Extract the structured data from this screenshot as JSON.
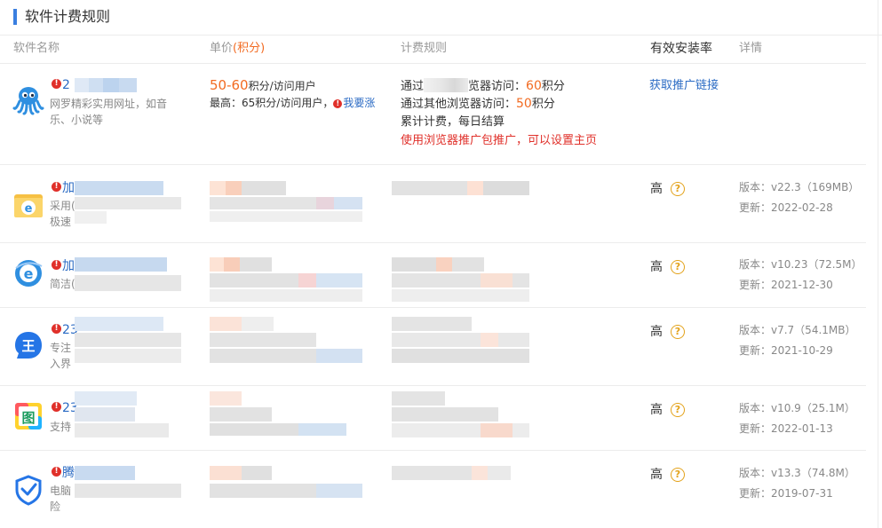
{
  "panel": {
    "title": "软件计费规则",
    "accent_color": "#3a7fe0"
  },
  "table": {
    "headers": {
      "name": "软件名称",
      "price": "单价",
      "price_suffix": "(积分)",
      "rule": "计费规则",
      "rate": "有效安装率",
      "detail": "详情"
    }
  },
  "featured": {
    "icon": "octopus-icon",
    "name": "2",
    "desc_line1": "网罗精彩实用网址，如音",
    "desc_line2": "乐、小说等",
    "price_range": "50-60",
    "price_unit": "积分/访问用户",
    "max_text": "最高：65积分/访问用户，",
    "raise_link": "我要涨",
    "rule1_prefix": "通过",
    "rule1_suffix": "览器访问：",
    "rule1_num": "60",
    "rule1_unit": "积分",
    "rule2_prefix": "通过其他浏览器访问：",
    "rule2_num": "50",
    "rule2_unit": "积分",
    "rule3": "累计计费，每日结算",
    "rule4": "使用浏览器推广包推广，可以设置主页",
    "action": "获取推广链接"
  },
  "rows": [
    {
      "icon": "ie-folder-icon",
      "name": "加",
      "desc_line1": "采用(",
      "desc_line2": "极速",
      "rate": "高",
      "version": "版本：v22.3（169MB）",
      "updated": "更新：2022-02-28"
    },
    {
      "icon": "ie-browser-icon",
      "name": "加",
      "desc_line1": "简洁(",
      "desc_line2": "",
      "rate": "高",
      "version": "版本：v10.23（72.5M）",
      "updated": "更新：2021-12-30"
    },
    {
      "icon": "wang-icon",
      "name": "23",
      "desc_line1": "专注",
      "desc_line2": "入界",
      "rate": "高",
      "version": "版本：v7.7（54.1MB）",
      "updated": "更新：2021-10-29"
    },
    {
      "icon": "picture-icon",
      "name": "23",
      "desc_line1": "支持",
      "desc_line2": "",
      "rate": "高",
      "version": "版本：v10.9（25.1M）",
      "updated": "更新：2022-01-13"
    },
    {
      "icon": "shield-check-icon",
      "name": "腾",
      "desc_line1": "电脑",
      "desc_line2": "险",
      "rate": "高",
      "version": "版本：v13.3（74.8M）",
      "updated": "更新：2019-07-31"
    }
  ],
  "help_mark": "?",
  "error_mark": "!"
}
